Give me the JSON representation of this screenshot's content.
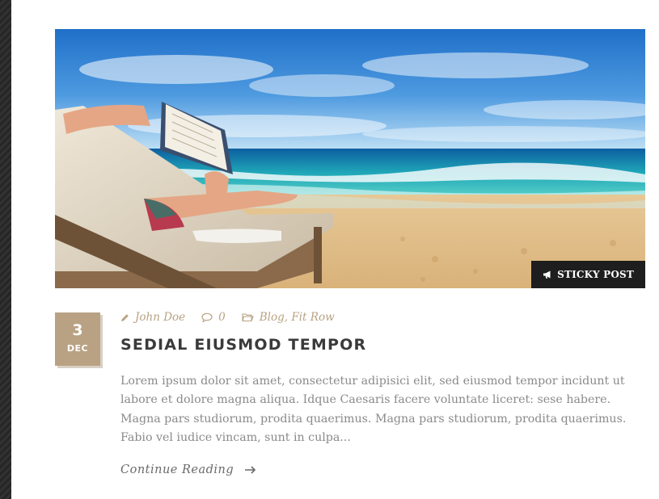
{
  "post": {
    "sticky_label": "STICKY POST",
    "date": {
      "day": "3",
      "month": "DEC"
    },
    "meta": {
      "author": "John Doe",
      "comments": "0",
      "categories": [
        "Blog",
        "Fit Row"
      ],
      "category_separator": ", "
    },
    "title": "SEDIAL EIUSMOD TEMPOR",
    "excerpt": "Lorem ipsum dolor sit amet, consectetur adipisici elit, sed eiusmod tempor incidunt ut labore et dolore magna aliqua. Idque Caesaris facere voluntate liceret: sese habere. Magna pars studiorum, prodita quaerimus. Magna pars studiorum, prodita quaerimus. Fabio vel iudice vincam, sunt in culpa...",
    "read_more": "Continue Reading"
  },
  "icons": {
    "sticky": "megaphone-icon",
    "author": "pencil-icon",
    "comments": "comment-icon",
    "categories": "folder-icon",
    "read_more": "arrow-right-icon"
  },
  "colors": {
    "accent": "#b8a283",
    "title": "#3a3a3a",
    "text": "#8a8a8a",
    "badge_bg": "#1e1e1e",
    "page_bg": "#2b2b2b"
  }
}
